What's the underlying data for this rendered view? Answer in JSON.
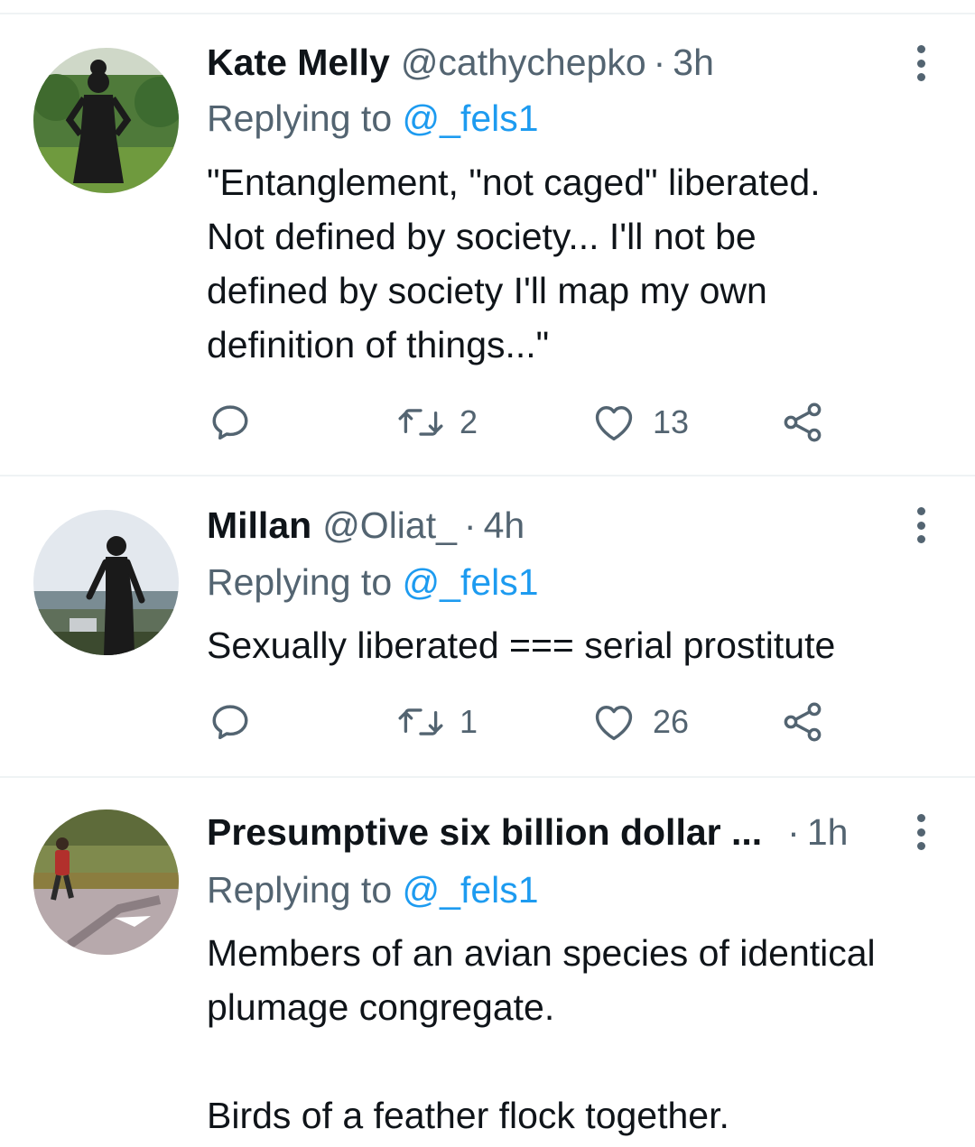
{
  "tweets": [
    {
      "name": "Kate Melly",
      "handle": "@cathychepko",
      "separator": "·",
      "time": "3h",
      "replying_prefix": "Replying to",
      "replying_to": "@_fels1",
      "text_lines": [
        "\"Entanglement, \"not caged\" liberated.",
        "Not defined by society... I'll not be",
        "defined by society I'll map my own",
        "definition of things...\""
      ],
      "retweets": "2",
      "likes": "13",
      "avatar_colors": {
        "sky": "#cfd8c8",
        "foliage": "#4f7a3a",
        "ground": "#6f9a3e",
        "figure": "#1b1b1b"
      }
    },
    {
      "name": "Millan",
      "handle": "@Oliat_",
      "separator": "·",
      "time": "4h",
      "replying_prefix": "Replying to",
      "replying_to": "@_fels1",
      "text_lines": [
        "Sexually liberated === serial prostitute"
      ],
      "retweets": "1",
      "likes": "26",
      "avatar_colors": {
        "sky": "#e3e8ee",
        "city": "#7a8c93",
        "figure": "#1a1a1a",
        "wall": "#3c4a2f"
      }
    },
    {
      "name": "Presumptive six billion dollar ...",
      "handle": "",
      "separator": "·",
      "time": "1h",
      "replying_prefix": "Replying to",
      "replying_to": "@_fels1",
      "text_lines": [
        "Members of an avian species of identical",
        "plumage congregate.",
        "",
        "Birds of a feather flock together."
      ],
      "avatar_colors": {
        "trees": "#5e6b3a",
        "grass": "#7f8a4d",
        "road": "#b7a9ac",
        "figure": "#b2302c"
      }
    }
  ],
  "icons": {
    "reply": "reply-icon",
    "retweet": "retweet-icon",
    "like": "heart-icon",
    "share": "share-icon",
    "more": "more-options-icon"
  },
  "colors": {
    "text_primary": "#0f1419",
    "text_secondary": "#536471",
    "link": "#1d9bf0",
    "divider": "#eff3f4"
  }
}
